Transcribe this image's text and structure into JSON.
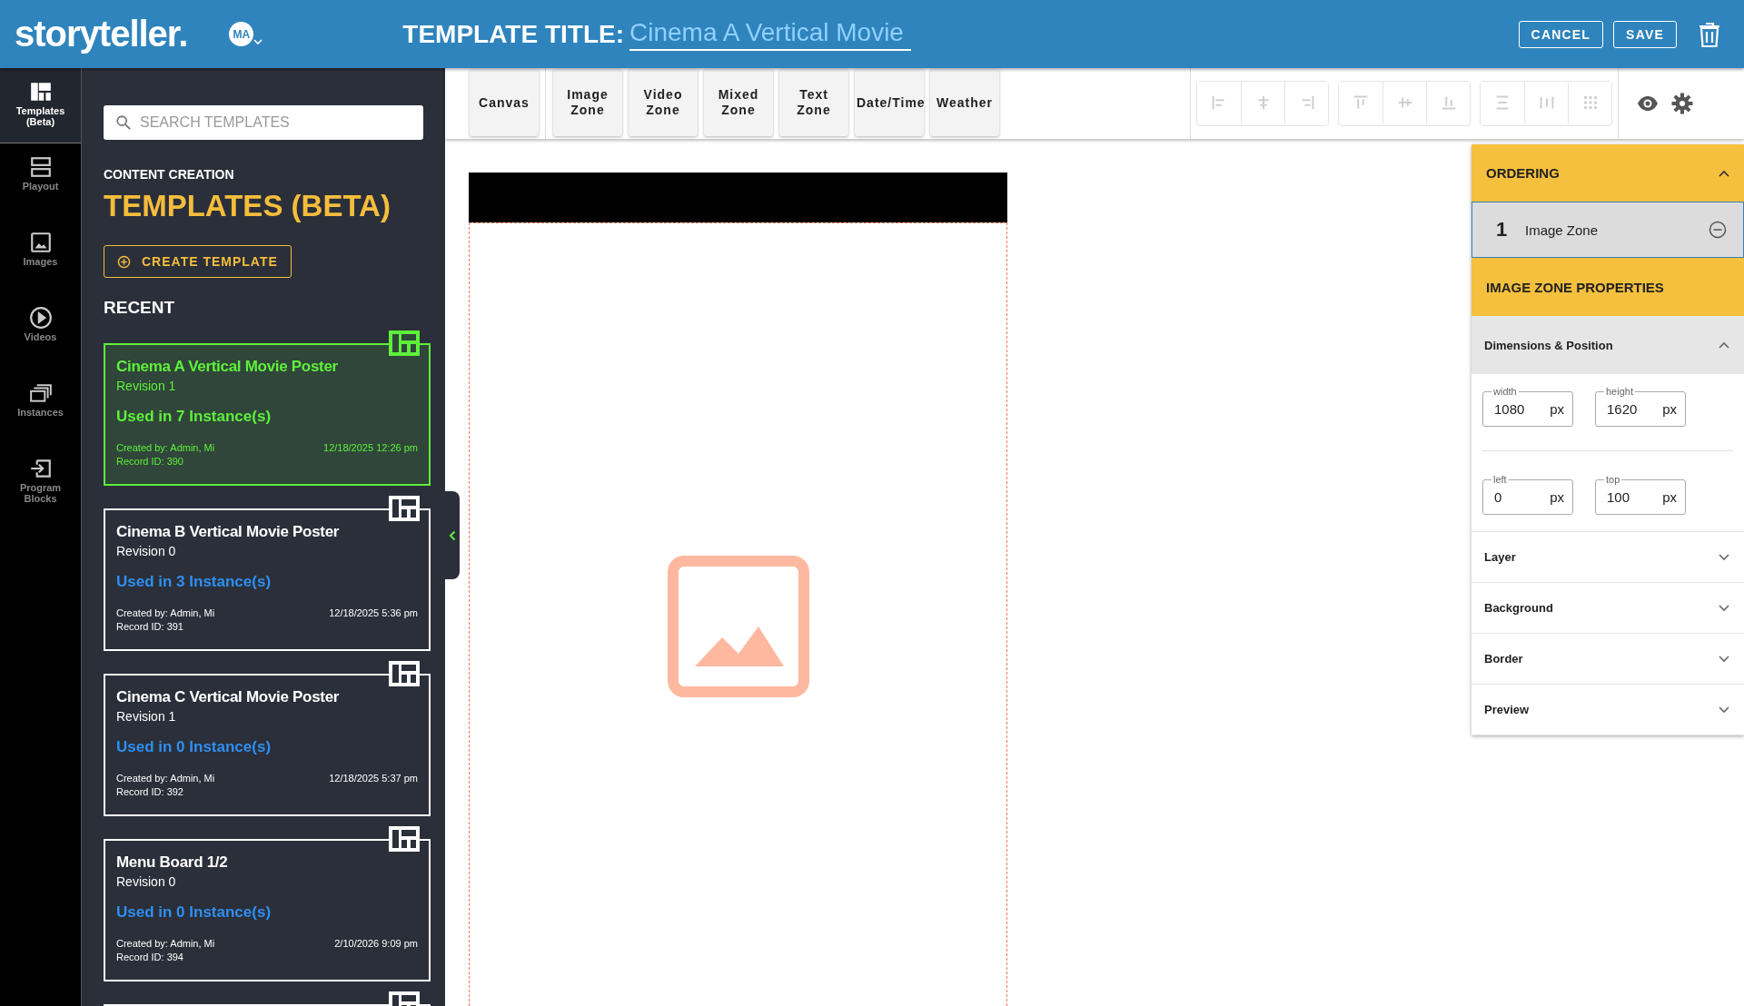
{
  "header": {
    "logo": "storyteller.",
    "avatar": "MA",
    "title_label": "TEMPLATE TITLE:",
    "title_value": "Cinema A Vertical Movie",
    "buttons": [
      "CANCEL",
      "SAVE"
    ]
  },
  "nav": [
    {
      "label": "Templates (Beta)",
      "kind": "templates",
      "selected": true
    },
    {
      "label": "Playout",
      "kind": "playout",
      "selected": false
    },
    {
      "label": "Images",
      "kind": "images",
      "selected": false
    },
    {
      "label": "Videos",
      "kind": "videos",
      "selected": false
    },
    {
      "label": "Instances",
      "kind": "instances",
      "selected": false
    },
    {
      "label": "Program Blocks",
      "kind": "blocks",
      "selected": false
    }
  ],
  "panel": {
    "search_placeholder": "SEARCH TEMPLATES",
    "eyebrow": "CONTENT CREATION",
    "heading": "TEMPLATES (BETA)",
    "create": "CREATE TEMPLATE",
    "recent": "RECENT",
    "cards": [
      {
        "title": "Cinema A Vertical Movie Poster",
        "revision": "Revision 1",
        "usage": "Used in 7 Instance(s)",
        "created": "Created by: Admin, Mi",
        "date": "12/18/2025 12:26 pm",
        "record": "Record ID: 390",
        "selected": true
      },
      {
        "title": "Cinema B Vertical Movie Poster",
        "revision": "Revision 0",
        "usage": "Used in 3 Instance(s)",
        "created": "Created by: Admin, Mi",
        "date": "12/18/2025 5:36 pm",
        "record": "Record ID: 391",
        "selected": false
      },
      {
        "title": "Cinema C Vertical Movie Poster",
        "revision": "Revision 1",
        "usage": "Used in 0 Instance(s)",
        "created": "Created by: Admin, Mi",
        "date": "12/18/2025 5:37 pm",
        "record": "Record ID: 392",
        "selected": false
      },
      {
        "title": "Menu Board 1/2",
        "revision": "Revision 0",
        "usage": "Used in 0 Instance(s)",
        "created": "Created by: Admin, Mi",
        "date": "2/10/2026 9:09 pm",
        "record": "Record ID: 394",
        "selected": false
      }
    ]
  },
  "toolbar": {
    "canvas": "Canvas",
    "zones": [
      "Image Zone",
      "Video Zone",
      "Mixed Zone",
      "Text Zone",
      "Date/Time",
      "Weather"
    ],
    "align_groups": [
      [
        {
          "kind": "left",
          "disabled": true
        },
        {
          "kind": "hcenter",
          "disabled": true
        },
        {
          "kind": "right",
          "disabled": true
        }
      ],
      [
        {
          "kind": "top",
          "disabled": true
        },
        {
          "kind": "vcenter",
          "disabled": true
        },
        {
          "kind": "bottom",
          "disabled": true
        }
      ],
      [
        {
          "kind": "vdist",
          "disabled": true
        },
        {
          "kind": "hdist",
          "disabled": true
        },
        {
          "kind": "grid",
          "disabled": true
        }
      ]
    ]
  },
  "properties": {
    "ordering_title": "ORDERING",
    "ordering_items": [
      {
        "number": "1",
        "label": "Image Zone",
        "selected": true
      }
    ],
    "zone_title": "IMAGE ZONE PROPERTIES",
    "sections": [
      {
        "title": "Dimensions & Position",
        "expanded": true,
        "rows": [
          [
            {
              "label": "width",
              "value": "1080",
              "unit": "px"
            },
            {
              "label": "height",
              "value": "1620",
              "unit": "px"
            }
          ],
          [
            {
              "label": "left",
              "value": "0",
              "unit": "px"
            },
            {
              "label": "top",
              "value": "100",
              "unit": "px"
            }
          ]
        ]
      },
      {
        "title": "Layer",
        "expanded": false
      },
      {
        "title": "Background",
        "expanded": false
      },
      {
        "title": "Border",
        "expanded": false
      },
      {
        "title": "Preview",
        "expanded": false
      }
    ]
  }
}
